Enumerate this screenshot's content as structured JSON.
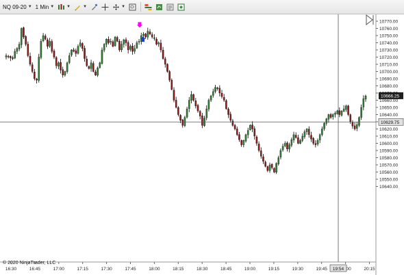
{
  "toolbar": {
    "instrument": "NQ 09-20",
    "interval": "1 Min"
  },
  "copyright": "© 2020 NinjaTrader, LLC",
  "colors": {
    "background": "#ffffff",
    "up_candle": "#2e7d32",
    "down_candle": "#8b1a1a",
    "wick": "#000000",
    "crosshair": "#555555",
    "marker_down": "#ff00ff",
    "marker_up": "#1f3ccf",
    "price_tag_bg": "#202020",
    "price_tag_text": "#ffffff",
    "cross_tag_bg": "#e0e0e0"
  },
  "chart_data": {
    "type": "candlestick",
    "ylim": [
      10640,
      10780
    ],
    "y_ticks": [
      "10770.00",
      "10760.00",
      "10750.00",
      "10740.00",
      "10730.00",
      "10720.00",
      "10710.00",
      "10700.00",
      "10690.00",
      "10680.00",
      "10670.00",
      "10660.00",
      "10650.00",
      "10640.00",
      "10630.00",
      "10620.00",
      "10610.00",
      "10600.00",
      "10590.00",
      "10580.00",
      "10570.00",
      "10560.00",
      "10550.00",
      "10640.00"
    ],
    "x_ticks": [
      "16:30",
      "16:45",
      "17:00",
      "17:15",
      "17:30",
      "17:45",
      "18:00",
      "18:15",
      "18:30",
      "18:45",
      "19:00",
      "19:15",
      "19:30",
      "19:45",
      "20:00",
      "20:15"
    ],
    "last_price": "10666.25",
    "crosshair_price": "10629.75",
    "crosshair_time": "19:54",
    "markers": [
      {
        "type": "down-arrow",
        "price": 10763
      },
      {
        "type": "up-arrow",
        "price": 10747
      }
    ],
    "closes": [
      10722,
      10721,
      10719,
      10718,
      10728,
      10732,
      10738,
      10760,
      10748,
      10738,
      10722,
      10710,
      10700,
      10690,
      10688,
      10720,
      10742,
      10750,
      10745,
      10735,
      10742,
      10728,
      10720,
      10708,
      10712,
      10702,
      10695,
      10700,
      10712,
      10722,
      10730,
      10728,
      10725,
      10735,
      10740,
      10732,
      10718,
      10708,
      10704,
      10712,
      10700,
      10695,
      10705,
      10712,
      10730,
      10738,
      10745,
      10740,
      10742,
      10735,
      10748,
      10742,
      10730,
      10738,
      10744,
      10740,
      10730,
      10735,
      10728,
      10732,
      10740,
      10742,
      10750,
      10752,
      10748,
      10756,
      10752,
      10748,
      10746,
      10738,
      10740,
      10730,
      10718,
      10710,
      10700,
      10688,
      10675,
      10660,
      10650,
      10640,
      10632,
      10625,
      10636,
      10648,
      10660,
      10668,
      10660,
      10652,
      10645,
      10638,
      10625,
      10635,
      10648,
      10660,
      10666,
      10672,
      10678,
      10676,
      10670,
      10665,
      10660,
      10648,
      10640,
      10632,
      10625,
      10620,
      10612,
      10605,
      10598,
      10604,
      10612,
      10618,
      10625,
      10620,
      10610,
      10600,
      10590,
      10582,
      10575,
      10568,
      10562,
      10570,
      10566,
      10560,
      10572,
      10580,
      10590,
      10596,
      10600,
      10592,
      10598,
      10605,
      10612,
      10608,
      10600,
      10604,
      10610,
      10616,
      10620,
      10612,
      10606,
      10600,
      10598,
      10604,
      10612,
      10620,
      10628,
      10634,
      10640,
      10636,
      10640,
      10642,
      10645,
      10640,
      10645,
      10648,
      10652,
      10640,
      10630,
      10624,
      10620,
      10626,
      10636,
      10650,
      10662,
      10666
    ]
  }
}
